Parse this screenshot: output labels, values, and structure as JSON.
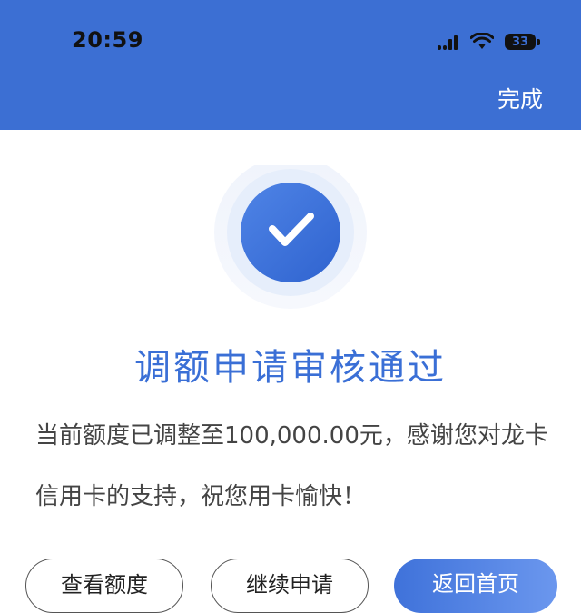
{
  "status_bar": {
    "time": "20:59",
    "battery": "33"
  },
  "header": {
    "done_label": "完成"
  },
  "result": {
    "title": "调额申请审核通过",
    "description": "当前额度已调整至100,000.00元，感谢您对龙卡信用卡的支持，祝您用卡愉快！"
  },
  "actions": {
    "buttons": [
      {
        "label": "查看额度"
      },
      {
        "label": "继续申请"
      },
      {
        "label": "返回首页"
      }
    ]
  },
  "colors": {
    "header_bg": "#3c6fd3",
    "accent": "#3a6fd6",
    "icon_circle": "#3c6fd6"
  },
  "icons": {
    "success": "checkmark-circle-icon",
    "signal": "cellular-signal-icon",
    "wifi": "wifi-icon",
    "battery": "battery-icon"
  }
}
